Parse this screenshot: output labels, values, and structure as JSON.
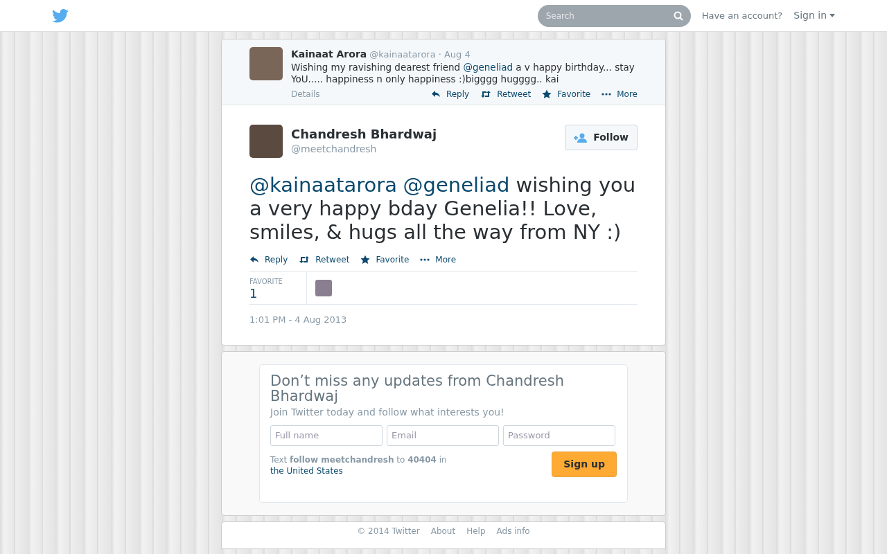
{
  "navbar": {
    "search": {
      "placeholder": "Search"
    },
    "account_prompt": "Have an account?",
    "sign_in": "Sign in"
  },
  "parent_tweet": {
    "name": "Kainaat Arora",
    "handle": "@kainaatarora",
    "time": "· Aug 4",
    "text": [
      {
        "kind": "text",
        "text": "Wishing my ravishing dearest friend "
      },
      {
        "kind": "mention",
        "text": "@geneliad"
      },
      {
        "kind": "text",
        "text": " a v happy birthday... stay YoU..... happiness n only happiness :)bigggg hugggg.. kai"
      }
    ],
    "details": "Details",
    "actions": [
      {
        "kind": "reply",
        "label": "Reply"
      },
      {
        "kind": "retweet",
        "label": "Retweet"
      },
      {
        "kind": "favorite",
        "label": "Favorite"
      },
      {
        "kind": "more",
        "label": "More"
      }
    ]
  },
  "tweet": {
    "name": "Chandresh Bhardwaj",
    "handle": "@meetchandresh",
    "follow": "Follow",
    "text": [
      {
        "kind": "mention",
        "text": "@kainaatarora"
      },
      {
        "kind": "mention",
        "text": "@geneliad"
      },
      {
        "kind": "text",
        "text": " wishing you a very happy bday Genelia!! Love, smiles, & hugs all the way from NY :)"
      }
    ],
    "actions": [
      {
        "kind": "reply",
        "label": "Reply"
      },
      {
        "kind": "retweet",
        "label": "Retweet"
      },
      {
        "kind": "favorite",
        "label": "Favorite"
      },
      {
        "kind": "more",
        "label": "More"
      }
    ],
    "stats": {
      "label": "FAVORITE",
      "count": "1"
    },
    "timestamp": "1:01 PM - 4 Aug 2013"
  },
  "signup": {
    "title": "Don’t miss any updates from Chandresh Bhardwaj",
    "subtitle": "Join Twitter today and follow what interests you!",
    "fields": [
      {
        "placeholder": "Full name"
      },
      {
        "placeholder": "Email"
      },
      {
        "placeholder": "Password"
      }
    ],
    "sms_text": "Text **follow meetchandresh** to **40404** in",
    "sms_link": "the United States",
    "button": "Sign up"
  },
  "footer": {
    "items": [
      "© 2014 Twitter",
      "About",
      "Help",
      "Ads info"
    ]
  }
}
